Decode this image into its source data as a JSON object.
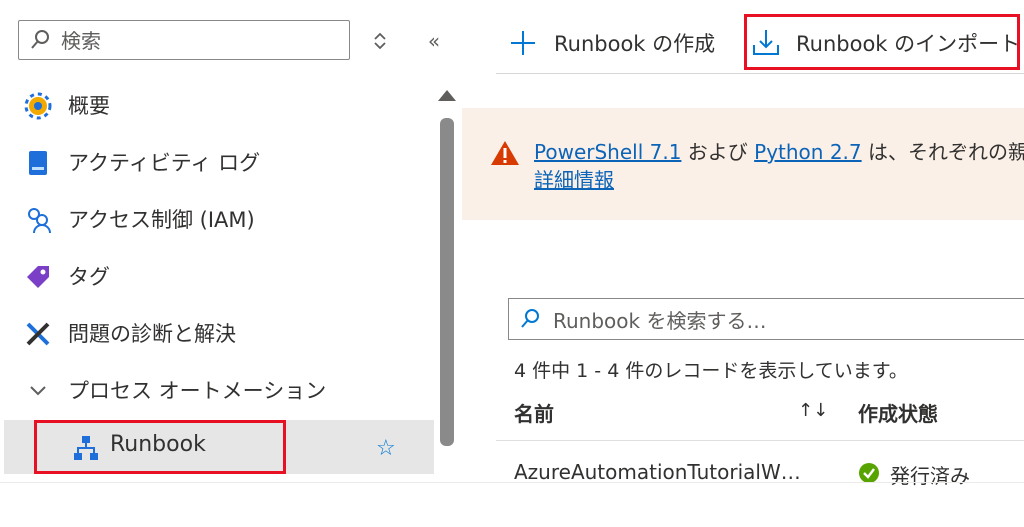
{
  "sidebar": {
    "search_placeholder": "検索",
    "collapse_glyph": "«",
    "items": [
      {
        "label": "概要",
        "icon": "gear-overview-icon"
      },
      {
        "label": "アクティビティ ログ",
        "icon": "activity-log-icon"
      },
      {
        "label": "アクセス制御 (IAM)",
        "icon": "people-access-icon"
      },
      {
        "label": "タグ",
        "icon": "tag-icon"
      },
      {
        "label": "問題の診断と解決",
        "icon": "wrench-icon"
      }
    ],
    "group": {
      "label": "プロセス オートメーション",
      "expanded": true
    },
    "selected": {
      "label": "Runbook",
      "icon": "runbook-hierarchy-icon",
      "favorite_glyph": "☆"
    }
  },
  "commands": {
    "create_label": "Runbook の作成",
    "import_label": "Runbook のインポート"
  },
  "warning": {
    "link1": "PowerShell 7.1",
    "text1": " および ",
    "link2": "Python 2.7",
    "text2": " は、それぞれの親製",
    "more_link": "詳細情報"
  },
  "runbooks": {
    "search_placeholder": "Runbook を検索する…",
    "count_text": "4 件中 1 - 4 件のレコードを表示しています。",
    "columns": {
      "name": "名前",
      "sort_glyph": "↑↓",
      "status": "作成状態"
    },
    "rows": [
      {
        "name": "AzureAutomationTutorialW…",
        "status": "発行済み"
      }
    ]
  },
  "colors": {
    "accent": "#0078d4",
    "highlight": "#e81123",
    "warning_bg": "#fbf0e8",
    "success": "#57a300"
  }
}
